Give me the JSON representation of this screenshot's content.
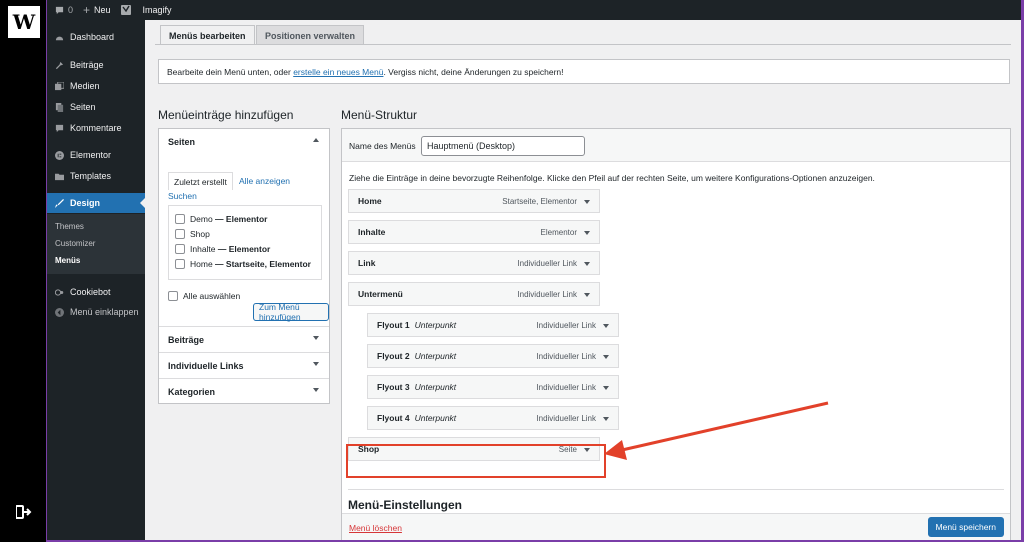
{
  "adminbar": {
    "comments_count": "0",
    "new_label": "Neu",
    "plugin_label": "Imagify"
  },
  "sidebar": {
    "items": [
      {
        "label": "Dashboard"
      },
      {
        "label": "Beiträge"
      },
      {
        "label": "Medien"
      },
      {
        "label": "Seiten"
      },
      {
        "label": "Kommentare"
      },
      {
        "label": "Elementor"
      },
      {
        "label": "Templates"
      },
      {
        "label": "Design"
      },
      {
        "label": "Cookiebot"
      },
      {
        "label": "Menü einklappen"
      }
    ],
    "submenu": [
      "Themes",
      "Customizer",
      "Menüs"
    ]
  },
  "tabs": {
    "edit": "Menüs bearbeiten",
    "locations": "Positionen verwalten"
  },
  "notice": {
    "before": "Bearbeite dein Menü unten, oder ",
    "link": "erstelle ein neues Menü",
    "after": ". Vergiss nicht, deine Änderungen zu speichern!"
  },
  "add_panel": {
    "heading": "Menüeinträge hinzufügen",
    "pages_label": "Seiten",
    "tab_recent": "Zuletzt erstellt",
    "tab_all": "Alle anzeigen",
    "tab_search": "Suchen",
    "pages": [
      {
        "name": "Demo",
        "suffix": " — Elementor"
      },
      {
        "name": "Shop",
        "suffix": ""
      },
      {
        "name": "Inhalte",
        "suffix": " — Elementor"
      },
      {
        "name": "Home",
        "suffix": " — Startseite, Elementor"
      }
    ],
    "select_all": "Alle auswählen",
    "add_button": "Zum Menü hinzufügen",
    "sections": [
      "Beiträge",
      "Individuelle Links",
      "Kategorien"
    ]
  },
  "structure": {
    "heading": "Menü-Struktur",
    "name_label": "Name des Menüs",
    "name_value": "Hauptmenü (Desktop)",
    "instruction": "Ziehe die Einträge in deine bevorzugte Reihenfolge. Klicke den Pfeil auf der rechten Seite, um weitere Konfigurations-Optionen anzuzeigen.",
    "items": [
      {
        "title": "Home",
        "sub": "",
        "type": "Startseite, Elementor",
        "level": 0
      },
      {
        "title": "Inhalte",
        "sub": "",
        "type": "Elementor",
        "level": 0
      },
      {
        "title": "Link",
        "sub": "",
        "type": "Individueller Link",
        "level": 0
      },
      {
        "title": "Untermenü",
        "sub": "",
        "type": "Individueller Link",
        "level": 0
      },
      {
        "title": "Flyout 1",
        "sub": "Unterpunkt",
        "type": "Individueller Link",
        "level": 1
      },
      {
        "title": "Flyout 2",
        "sub": "Unterpunkt",
        "type": "Individueller Link",
        "level": 1
      },
      {
        "title": "Flyout 3",
        "sub": "Unterpunkt",
        "type": "Individueller Link",
        "level": 1
      },
      {
        "title": "Flyout 4",
        "sub": "Unterpunkt",
        "type": "Individueller Link",
        "level": 1
      },
      {
        "title": "Shop",
        "sub": "",
        "type": "Seite",
        "level": 0
      }
    ],
    "settings_heading": "Menü-Einstellungen",
    "delete_label": "Menü löschen",
    "save_label": "Menü speichern"
  },
  "colors": {
    "accent": "#2271b1",
    "sidebar_bg": "#1d2327",
    "highlight": "#e2412a",
    "frame": "#7a3ea8"
  }
}
